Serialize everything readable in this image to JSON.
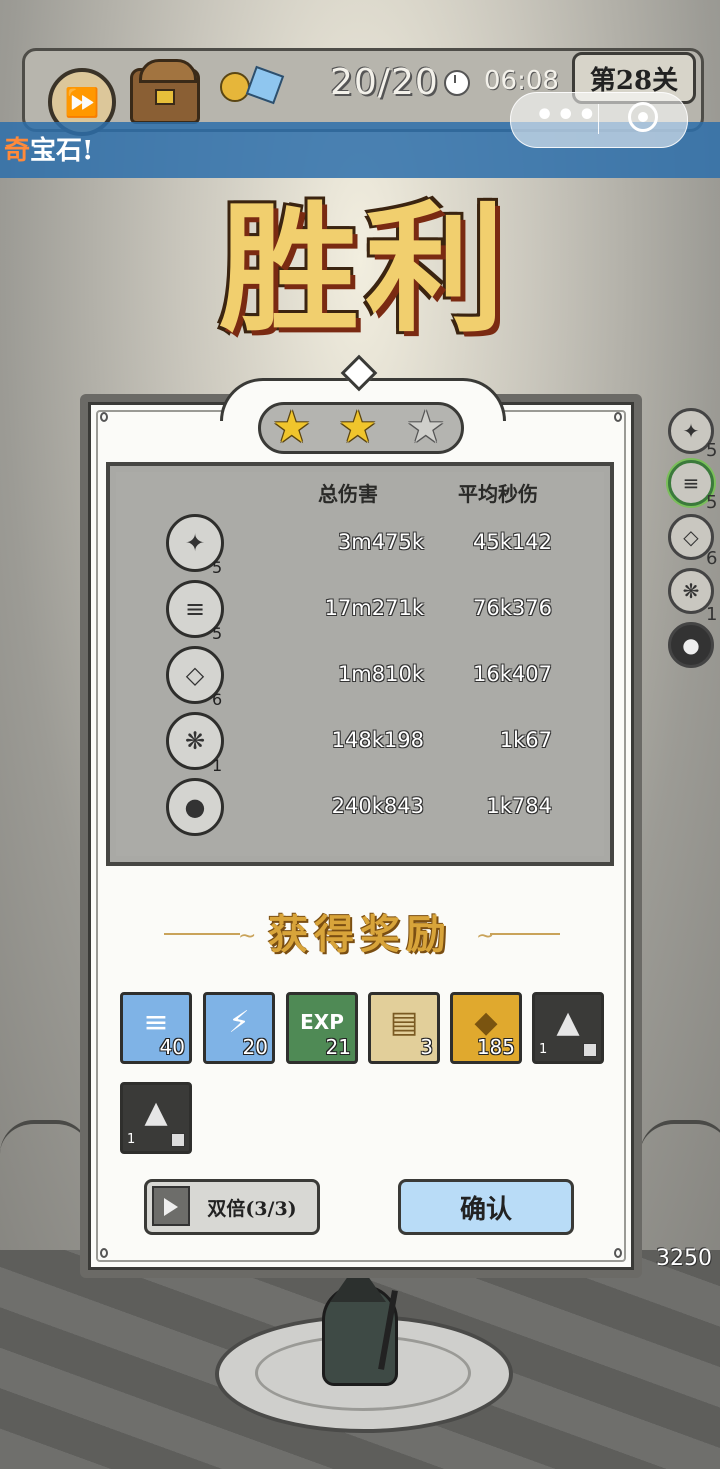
{
  "hud": {
    "resource_count": "20/20",
    "timer": "06:08",
    "level": "第28关",
    "icons": [
      "fast-forward-icon",
      "treasure-chest-icon",
      "coin-icon",
      "gem-icon",
      "clock-icon"
    ]
  },
  "miniprogram": {
    "icons": [
      "more-icon",
      "target-icon"
    ]
  },
  "banner": {
    "highlight": "奇",
    "text": "宝石!"
  },
  "victory_title": "胜利",
  "side_skills": [
    {
      "icon": "ink-splash-icon",
      "count": "5"
    },
    {
      "icon": "tornado-icon",
      "count": "5"
    },
    {
      "icon": "crystal-shard-icon",
      "count": "6"
    },
    {
      "icon": "crystal-cluster-icon",
      "count": "1"
    },
    {
      "icon": "ink-drop-icon",
      "count": ""
    }
  ],
  "result": {
    "stars": {
      "earned": 2,
      "total": 3
    },
    "headers": {
      "total_damage": "总伤害",
      "avg_dps": "平均秒伤"
    },
    "rows": [
      {
        "icon": "ink-splash-icon",
        "level": "5",
        "total_damage": "3m475k",
        "avg_dps": "45k142"
      },
      {
        "icon": "tornado-icon",
        "level": "5",
        "total_damage": "17m271k",
        "avg_dps": "76k376"
      },
      {
        "icon": "crystal-shard-icon",
        "level": "6",
        "total_damage": "1m810k",
        "avg_dps": "16k407"
      },
      {
        "icon": "crystal-cluster-icon",
        "level": "1",
        "total_damage": "148k198",
        "avg_dps": "1k67"
      },
      {
        "icon": "ink-drop-icon",
        "level": "",
        "total_damage": "240k843",
        "avg_dps": "1k784"
      }
    ]
  },
  "rewards": {
    "title": "获得奖励",
    "items": [
      {
        "icon": "tornado-gem-icon",
        "count": "40",
        "bg": "#7fb3e6"
      },
      {
        "icon": "lightning-gem-icon",
        "count": "20",
        "bg": "#7fb3e6"
      },
      {
        "icon": "exp-icon",
        "count": "21",
        "bg": "#4f8a55"
      },
      {
        "icon": "scroll-icon",
        "count": "3",
        "bg": "#e2cf9a"
      },
      {
        "icon": "gold-coin-icon",
        "count": "185",
        "bg": "#e0a92e"
      },
      {
        "icon": "stone-icon",
        "count": "1",
        "bg": "#3a3a38"
      },
      {
        "icon": "stone-icon",
        "count": "1",
        "bg": "#3a3a38"
      }
    ]
  },
  "buttons": {
    "double": "双倍(3/3)",
    "confirm": "确认"
  },
  "score": "3250"
}
